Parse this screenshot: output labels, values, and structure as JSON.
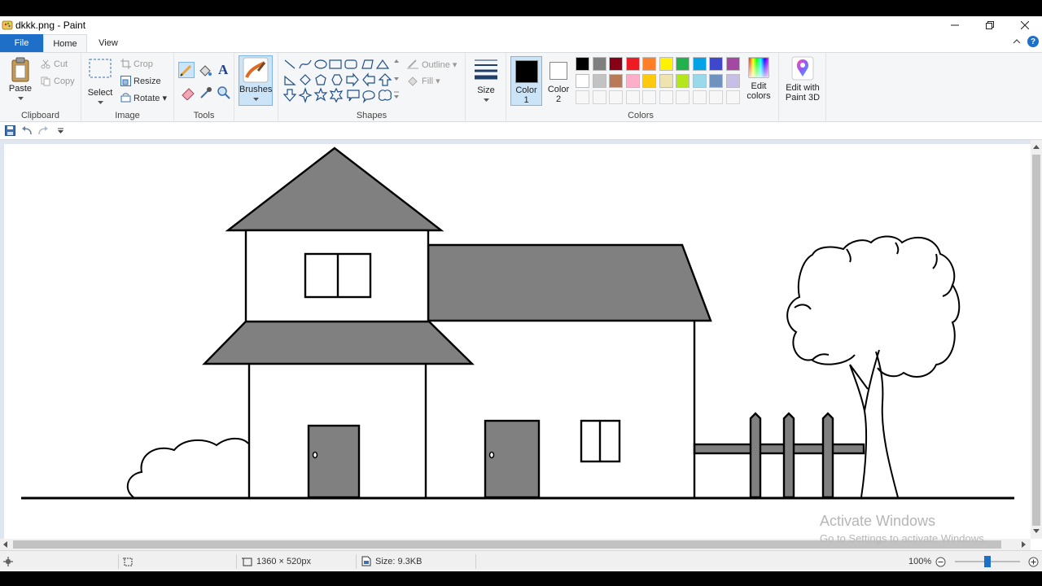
{
  "window": {
    "title": "dkkk.png - Paint"
  },
  "tabs": {
    "file": "File",
    "home": "Home",
    "view": "View"
  },
  "clipboard": {
    "paste": "Paste",
    "cut": "Cut",
    "copy": "Copy",
    "label": "Clipboard"
  },
  "image": {
    "select": "Select",
    "crop": "Crop",
    "resize": "Resize",
    "rotate": "Rotate",
    "label": "Image"
  },
  "tools": {
    "label": "Tools",
    "text_tool": "A"
  },
  "brushes": {
    "label": "Brushes"
  },
  "shapes": {
    "label": "Shapes",
    "outline": "Outline",
    "fill": "Fill"
  },
  "size": {
    "label": "Size"
  },
  "color1": {
    "line1": "Color",
    "line2": "1",
    "color": "#000000"
  },
  "color2": {
    "line1": "Color",
    "line2": "2",
    "color": "#ffffff"
  },
  "colors": {
    "label": "Colors",
    "palette_row1": [
      "#000000",
      "#7f7f7f",
      "#880015",
      "#ed1c24",
      "#ff7f27",
      "#fff200",
      "#22b14c",
      "#00a2e8",
      "#3f48cc",
      "#a349a4"
    ],
    "palette_row2": [
      "#ffffff",
      "#c3c3c3",
      "#b97a57",
      "#ffaec9",
      "#ffc90e",
      "#efe4b0",
      "#b5e61d",
      "#99d9ea",
      "#7092be",
      "#c8bfe7"
    ],
    "edit_line1": "Edit",
    "edit_line2": "colors"
  },
  "paint3d": {
    "line1": "Edit with",
    "line2": "Paint 3D"
  },
  "status": {
    "dimensions": "1360 × 520px",
    "size": "Size: 9.3KB",
    "zoom": "100%"
  },
  "watermark": {
    "line1": "Activate Windows",
    "line2": "Go to Settings to activate Windows."
  },
  "drawing": {
    "fill_color": "#808080",
    "stroke_color": "#000000"
  }
}
